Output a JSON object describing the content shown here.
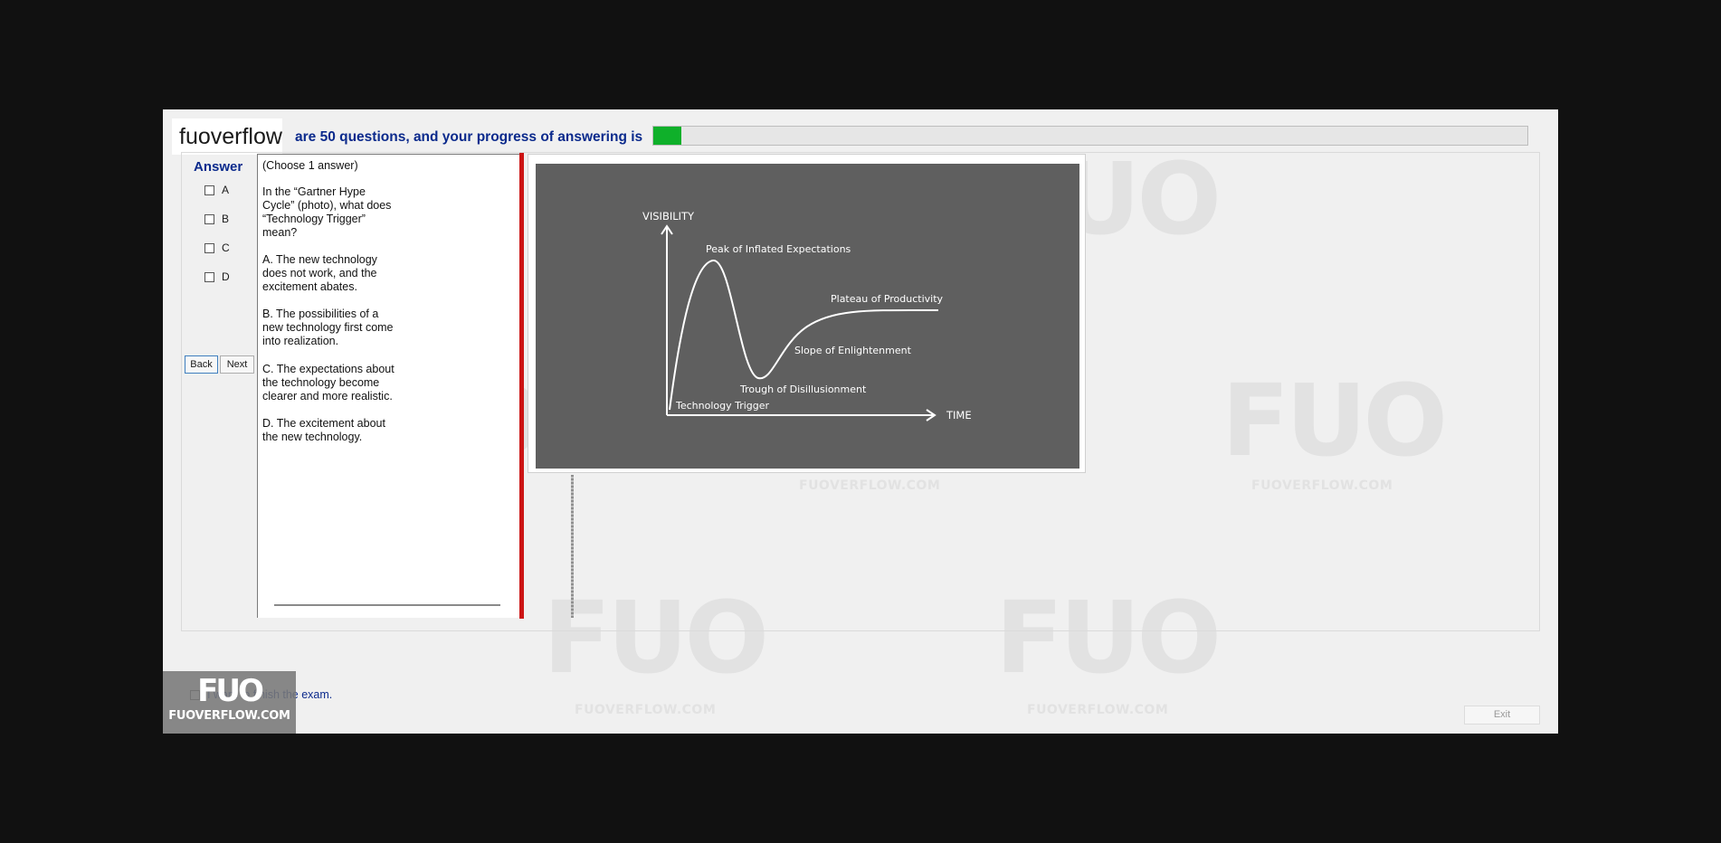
{
  "header": {
    "brand": "fuoverflow",
    "progress_text": "are 50 questions, and your progress of answering is",
    "progress_fraction": 0.032,
    "progress_color": "#0fb02a"
  },
  "answer": {
    "label": "Answer",
    "options": [
      "A",
      "B",
      "C",
      "D"
    ]
  },
  "nav": {
    "back_label": "Back",
    "next_label": "Next"
  },
  "question": {
    "instruction": "(Choose 1 answer)",
    "stem": [
      "In the “Gartner Hype",
      "Cycle” (photo), what does",
      "“Technology Trigger”",
      "mean?"
    ],
    "options": [
      [
        "A.  The new technology",
        "does not work, and the",
        "excitement abates."
      ],
      [
        "B.  The possibilities of a",
        "new technology first come",
        "into realization."
      ],
      [
        "C.  The expectations about",
        "the technology become",
        "clearer and more realistic."
      ],
      [
        "D.  The excitement about",
        "the new technology."
      ]
    ]
  },
  "hype_cycle_image": {
    "y_label": "VISIBILITY",
    "x_label": "TIME",
    "phases": {
      "peak": "Peak of Inflated Expectations",
      "plateau": "Plateau of Productivity",
      "slope": "Slope of Enlightenment",
      "trough": "Trough of Disillusionment",
      "trigger": "Technology Trigger"
    }
  },
  "watermark": {
    "big": "FUO",
    "small": "FUOVERFLOW.COM"
  },
  "footer": {
    "finish_label": "I want to finish the exam.",
    "exit_label": "Exit"
  },
  "logo_badge": {
    "line1": "FUO",
    "line2": "FUOVERFLOW.COM"
  }
}
